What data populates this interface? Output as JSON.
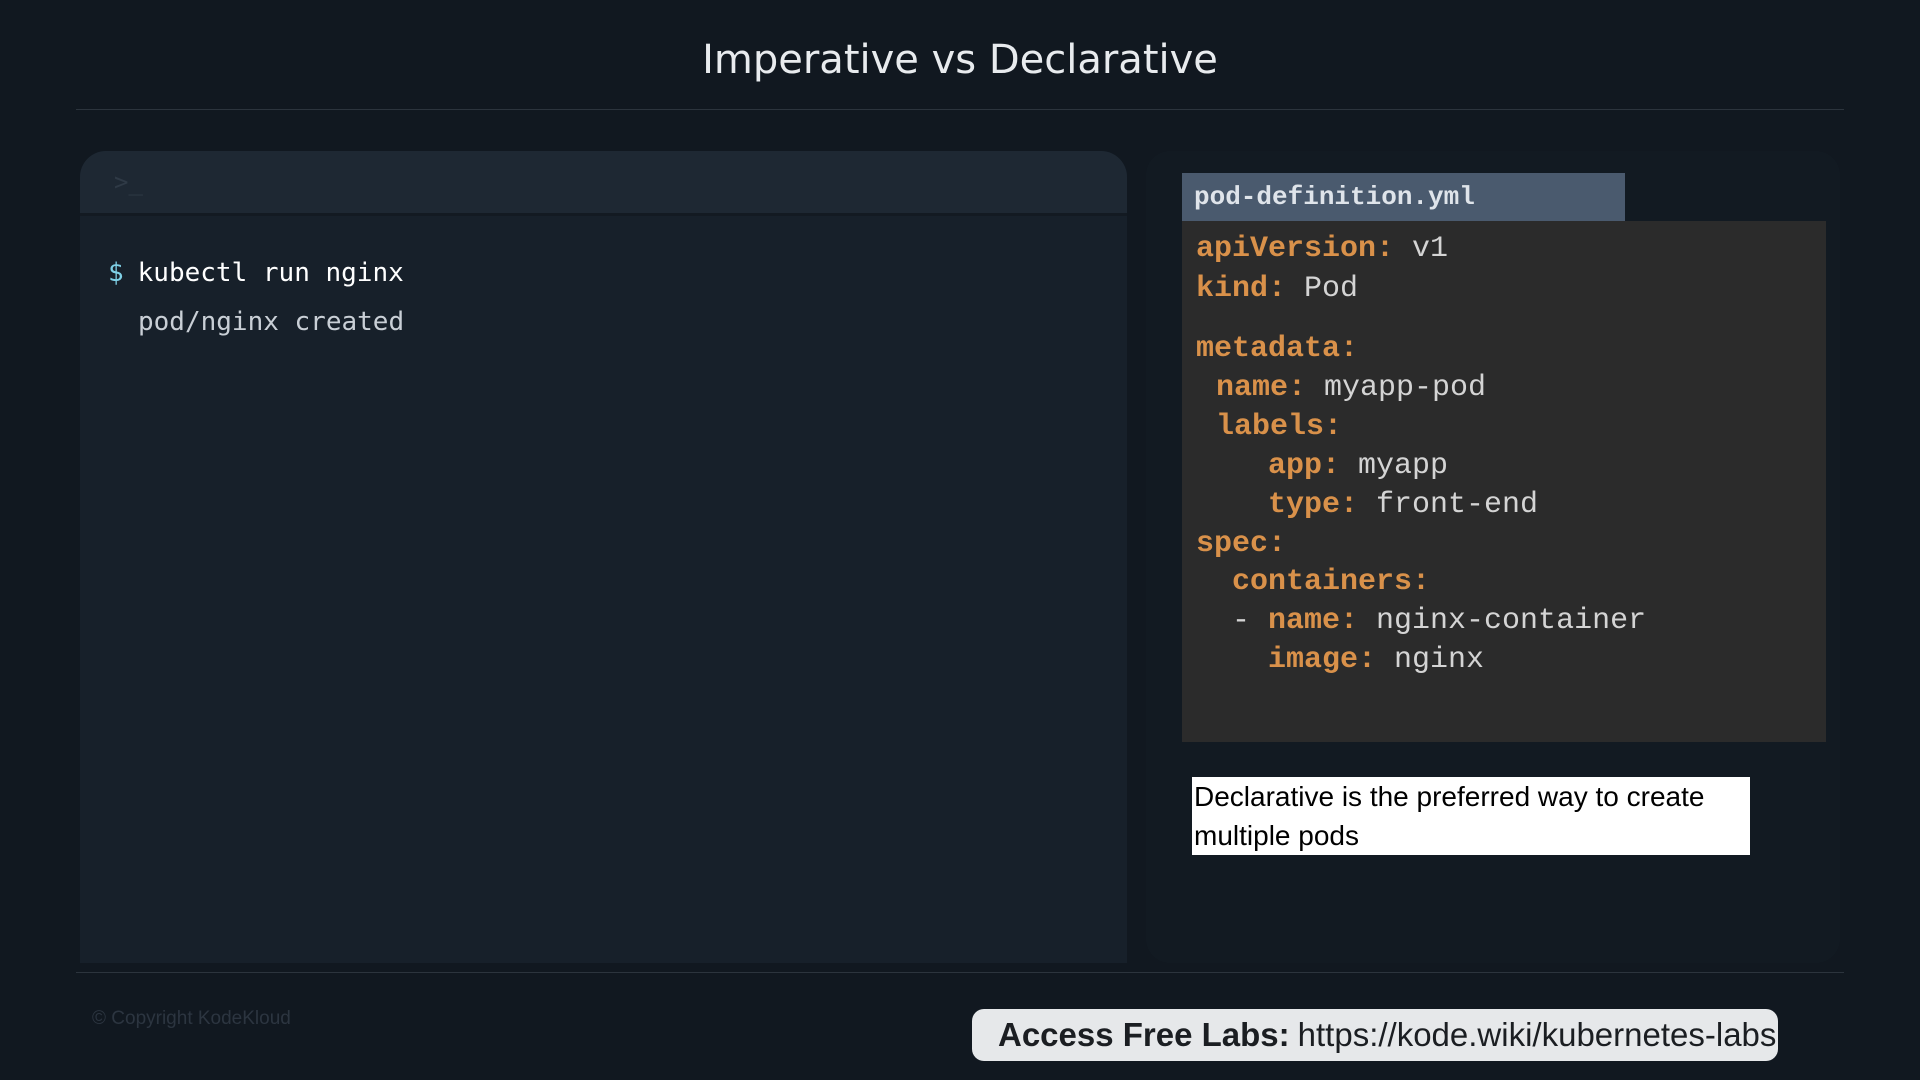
{
  "slide": {
    "title": "Imperative vs Declarative"
  },
  "terminal": {
    "prompt_icon": ">_",
    "prompt_symbol": "$",
    "command": "kubectl run nginx",
    "output": "pod/nginx created"
  },
  "yaml_file": {
    "filename": "pod-definition.yml",
    "lines": [
      {
        "indent": "",
        "key": "apiVersion:",
        "value": " v1"
      },
      {
        "indent": "",
        "key": "kind:",
        "value": " Pod"
      },
      {
        "indent": "",
        "key": "metadata:",
        "value": ""
      },
      {
        "indent": " ",
        "key": "name:",
        "value": " myapp-pod"
      },
      {
        "indent": " ",
        "key": "labels:",
        "value": ""
      },
      {
        "indent": "    ",
        "key": "app:",
        "value": " myapp"
      },
      {
        "indent": "    ",
        "key": "type:",
        "value": " front-end"
      },
      {
        "indent": "",
        "key": "spec:",
        "value": ""
      },
      {
        "indent": "  ",
        "key": "containers:",
        "value": ""
      },
      {
        "indent": "  - ",
        "key": "name:",
        "value": " nginx-container"
      },
      {
        "indent": "    ",
        "key": "image:",
        "value": " nginx"
      }
    ]
  },
  "caption": {
    "text": "Declarative is the preferred way to create multiple pods"
  },
  "footer": {
    "copyright": "© Copyright KodeKloud",
    "labs_label": "Access Free Labs:",
    "labs_url": "https://kode.wiki/kubernetes-labs"
  },
  "colors": {
    "background": "#111820",
    "terminal_bg": "#17202a",
    "yaml_key": "#d9914a",
    "yaml_value": "#d4d4d4",
    "yaml_tab": "#4a5a6e",
    "prompt_symbol": "#7fd0e6"
  }
}
